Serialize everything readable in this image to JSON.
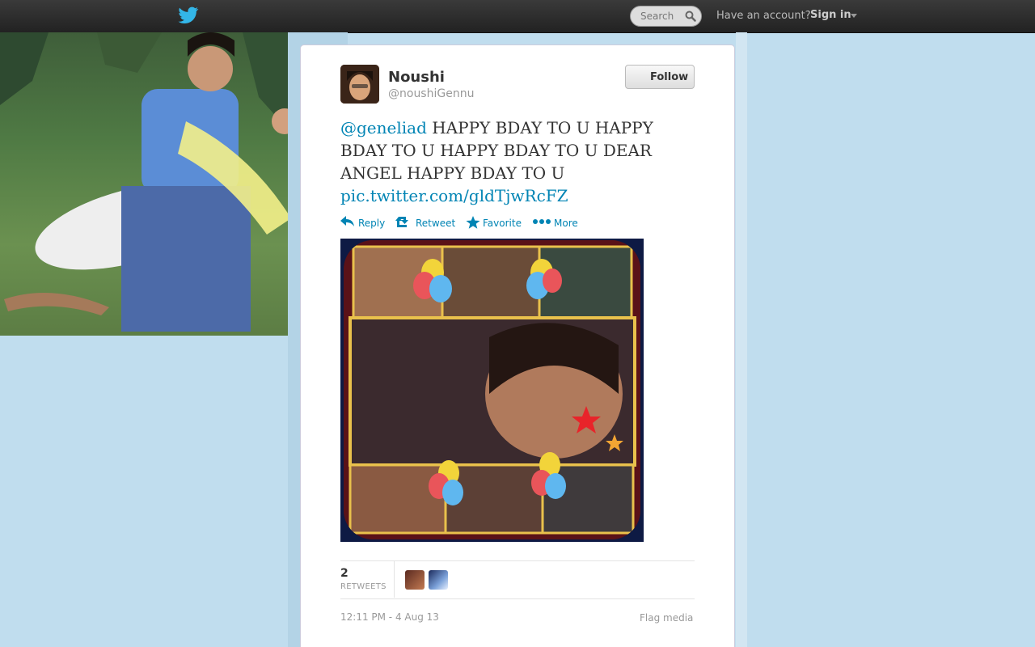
{
  "topbar": {
    "search_placeholder": "Search",
    "have_account": "Have an account?",
    "sign_in": "Sign in",
    "icons": [
      "twitter-bird-icon",
      "search-icon",
      "caret-down-icon"
    ]
  },
  "profile": {
    "name": "Noushi",
    "handle": "@noushiGennu",
    "follow_label": "Follow"
  },
  "tweet": {
    "mention": "@geneliad",
    "text": " HAPPY BDAY TO U HAPPY BDAY TO U HAPPY BDAY TO U DEAR ANGEL HAPPY BDAY TO U ",
    "link": "pic.twitter.com/gldTjwRcFZ"
  },
  "actions": {
    "reply": "Reply",
    "retweet": "Retweet",
    "favorite": "Favorite",
    "more": "More"
  },
  "stats": {
    "retweet_count": "2",
    "retweet_label": "RETWEETS"
  },
  "footer": {
    "timestamp": "12:11 PM - 4 Aug 13",
    "flag_media": "Flag media"
  },
  "colors": {
    "link": "#0084b4",
    "background": "#c0ddee",
    "topbar": "#2a2a2a"
  }
}
